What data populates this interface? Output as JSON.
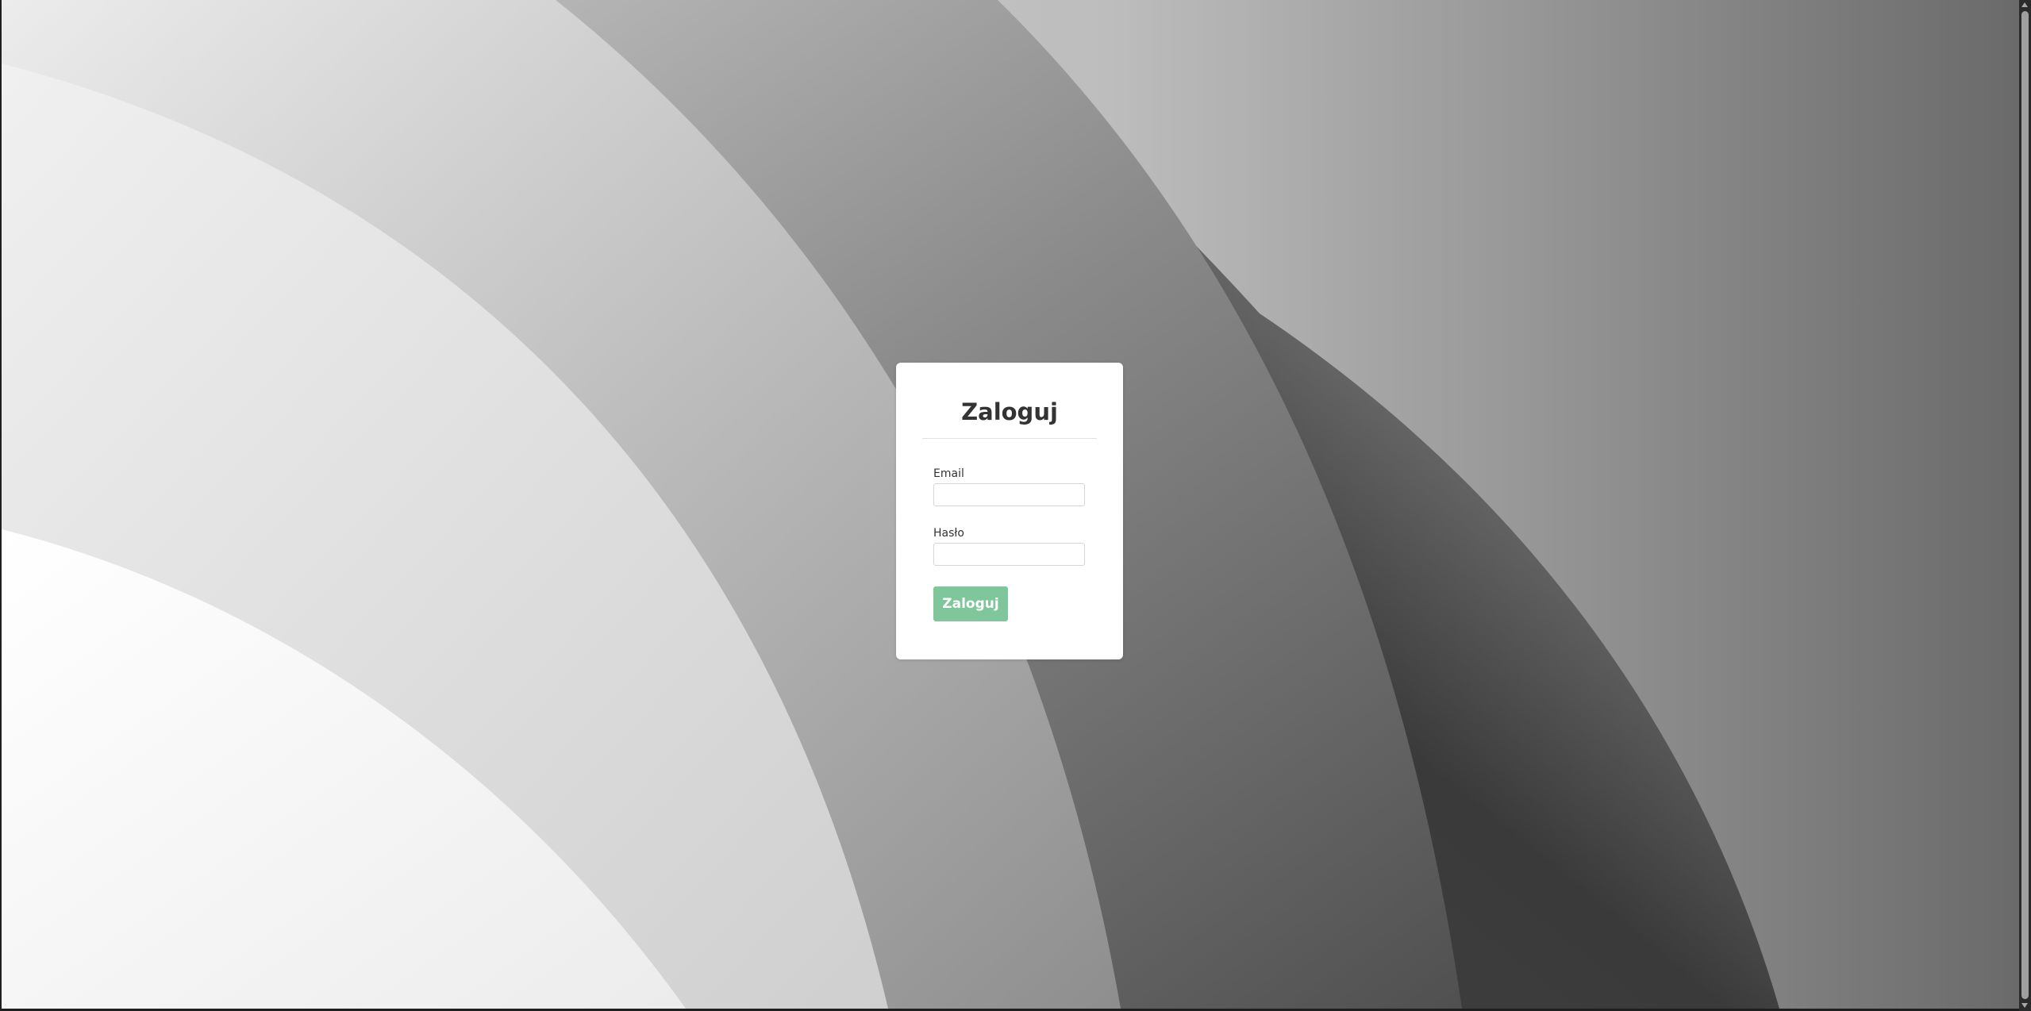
{
  "login": {
    "title": "Zaloguj",
    "email_label": "Email",
    "email_value": "",
    "password_label": "Hasło",
    "password_value": "",
    "submit_label": "Zaloguj"
  },
  "colors": {
    "submit_button": "#7fc79a",
    "card_background": "#ffffff",
    "text": "#333333"
  }
}
